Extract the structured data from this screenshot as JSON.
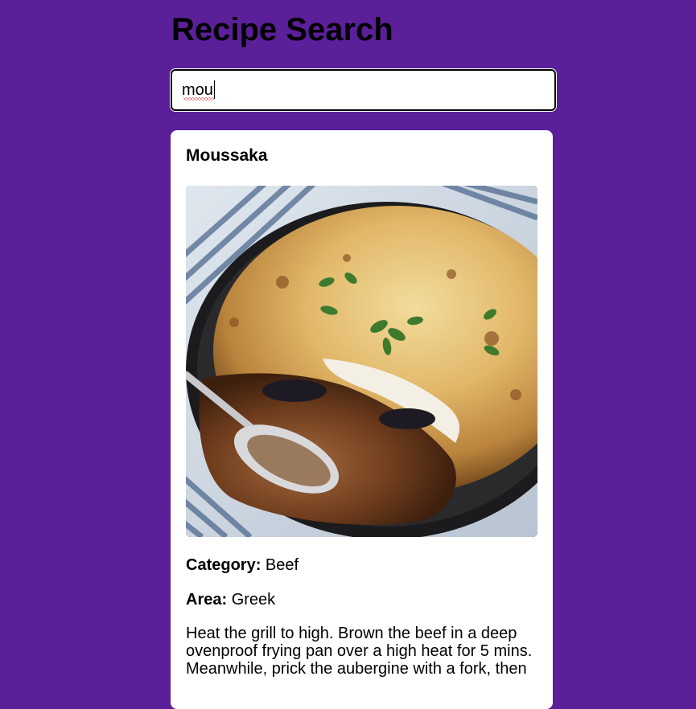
{
  "header": {
    "title": "Recipe Search"
  },
  "search": {
    "value": "mou",
    "placeholder": ""
  },
  "recipe": {
    "name": "Moussaka",
    "image_icon": "food-photo",
    "category_label": "Category:",
    "category": "Beef",
    "area_label": "Area:",
    "area": "Greek",
    "instructions": "Heat the grill to high. Brown the beef in a deep ovenproof frying pan over a high heat for 5 mins. Meanwhile, prick the aubergine with a fork, then"
  },
  "colors": {
    "background": "#5b1f99",
    "card": "#ffffff"
  }
}
